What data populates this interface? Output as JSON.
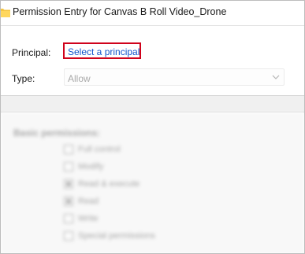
{
  "window": {
    "title": "Permission Entry for Canvas B Roll Video_Drone"
  },
  "principal": {
    "label": "Principal:",
    "link": "Select a principal"
  },
  "type": {
    "label": "Type:",
    "value": "Allow"
  },
  "permissions": {
    "heading": "Basic permissions:",
    "items": [
      {
        "label": "Full control",
        "checked": false
      },
      {
        "label": "Modify",
        "checked": false
      },
      {
        "label": "Read & execute",
        "checked": true
      },
      {
        "label": "Read",
        "checked": true
      },
      {
        "label": "Write",
        "checked": false
      },
      {
        "label": "Special permissions",
        "checked": false
      }
    ]
  },
  "colors": {
    "highlight_border": "#d0021b",
    "link": "#1155cc",
    "folder_icon": "#f4c542"
  }
}
